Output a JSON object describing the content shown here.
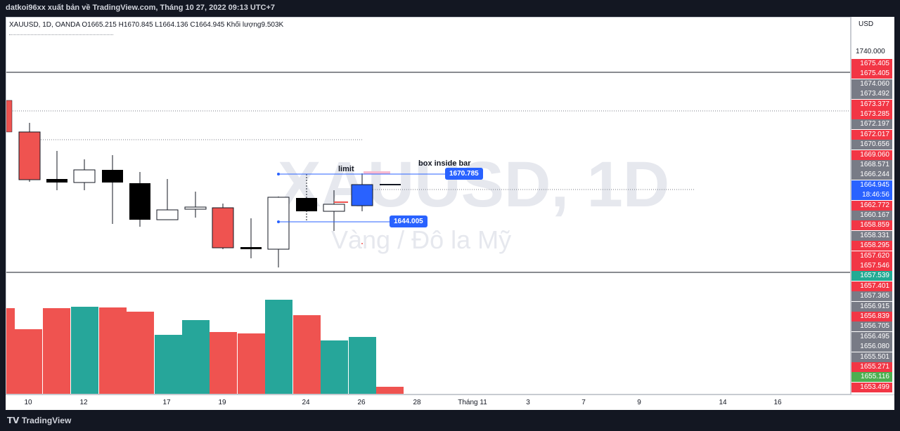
{
  "header": {
    "publisher_line": "datkoi96xx xuất bản về TradingView.com, Tháng 10 27, 2022 09:13 UTC+7"
  },
  "legend": {
    "text": "XAUUSD, 1D, OANDA  O1665.215  H1670.845  L1664.136  C1664.945  Khối lượng9.503K"
  },
  "watermark": {
    "symbol": "XAUUSD, 1D",
    "name": "Vàng / Đô la Mỹ"
  },
  "annotations": {
    "limit": "limit",
    "box": "box inside bar",
    "tag_top": "1670.785",
    "tag_bottom": "1644.005"
  },
  "price_scale": {
    "currency": "USD",
    "top_value": "1740.000",
    "levels": [
      {
        "v": "1675.405",
        "c": "#f23645"
      },
      {
        "v": "1675.405",
        "c": "#f23645"
      },
      {
        "v": "1674.060",
        "c": "#787b86"
      },
      {
        "v": "1673.492",
        "c": "#787b86"
      },
      {
        "v": "1673.377",
        "c": "#f23645"
      },
      {
        "v": "1673.285",
        "c": "#f23645"
      },
      {
        "v": "1672.197",
        "c": "#787b86"
      },
      {
        "v": "1672.017",
        "c": "#f23645"
      },
      {
        "v": "1670.656",
        "c": "#787b86"
      },
      {
        "v": "1669.060",
        "c": "#f23645"
      },
      {
        "v": "1668.571",
        "c": "#787b86"
      },
      {
        "v": "1666.244",
        "c": "#787b86"
      },
      {
        "v": "1664.945",
        "c": "#2962ff",
        "sub": "18:46:56"
      },
      {
        "v": "1662.772",
        "c": "#f23645"
      },
      {
        "v": "1660.167",
        "c": "#787b86"
      },
      {
        "v": "1658.859",
        "c": "#f23645"
      },
      {
        "v": "1658.331",
        "c": "#787b86"
      },
      {
        "v": "1658.295",
        "c": "#f23645"
      },
      {
        "v": "1657.620",
        "c": "#f23645"
      },
      {
        "v": "1657.546",
        "c": "#f23645"
      },
      {
        "v": "1657.539",
        "c": "#22ab94"
      },
      {
        "v": "1657.401",
        "c": "#f23645"
      },
      {
        "v": "1657.365",
        "c": "#787b86"
      },
      {
        "v": "1656.915",
        "c": "#787b86"
      },
      {
        "v": "1656.839",
        "c": "#f23645"
      },
      {
        "v": "1656.705",
        "c": "#787b86"
      },
      {
        "v": "1656.495",
        "c": "#787b86"
      },
      {
        "v": "1656.080",
        "c": "#787b86"
      },
      {
        "v": "1655.501",
        "c": "#787b86"
      },
      {
        "v": "1655.271",
        "c": "#f23645"
      },
      {
        "v": "1655.116",
        "c": "#4caf50"
      },
      {
        "v": "1653.499",
        "c": "#f23645"
      }
    ]
  },
  "time_axis": {
    "ticks": [
      "10",
      "12",
      "17",
      "19",
      "24",
      "26",
      "28",
      "Tháng 11",
      "3",
      "7",
      "9",
      "14",
      "16"
    ]
  },
  "footer": {
    "brand": "TradingView"
  },
  "colors": {
    "bull": "#ffffff",
    "bear": "#000000",
    "up_red": "#ef5350",
    "vol_up": "#26a69a",
    "vol_down": "#ef5350",
    "line_blue": "#2962ff"
  }
}
